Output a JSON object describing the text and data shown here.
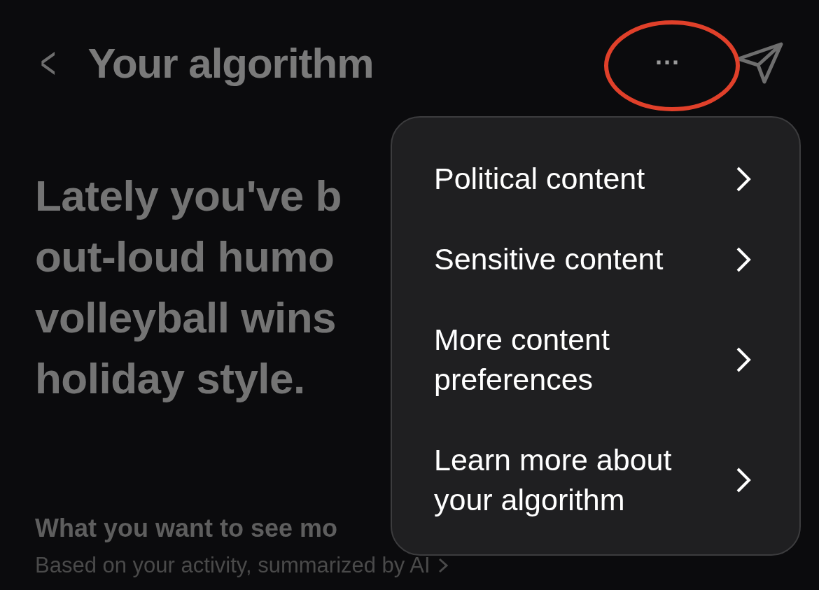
{
  "header": {
    "back": "<",
    "title": "Your algorithm",
    "more": "···"
  },
  "headline": [
    "Lately you've b",
    "out-loud humo",
    "volleyball wins",
    "holiday style."
  ],
  "section": {
    "title": "What you want to see mo",
    "subtitle": "Based on your activity, summarized by AI"
  },
  "menu": [
    {
      "label": "Political content"
    },
    {
      "label": "Sensitive content"
    },
    {
      "label": "More content preferences"
    },
    {
      "label": "Learn more about your algorithm"
    }
  ]
}
